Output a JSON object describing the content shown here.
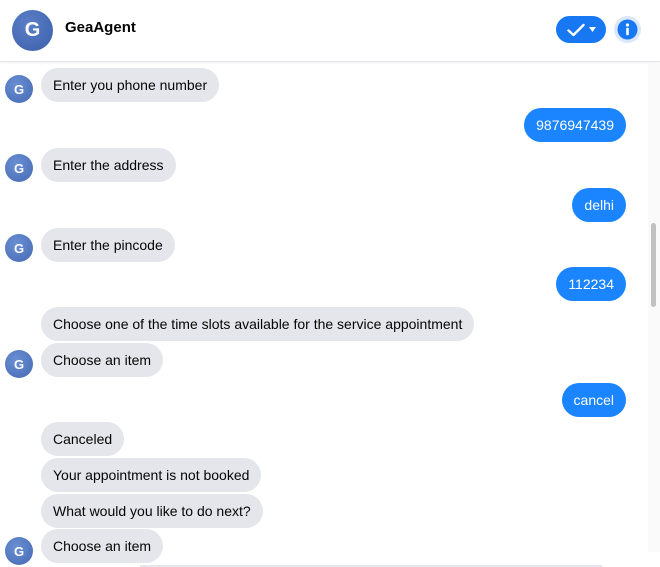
{
  "header": {
    "avatar_letter": "G",
    "title": "GeaAgent"
  },
  "icons": {
    "status": "check-icon",
    "dropdown": "chevron-down-icon",
    "info": "info-icon"
  },
  "colors": {
    "accent": "#1877f2",
    "user_bubble": "#1a85ff",
    "bot_bubble": "#e4e6eb",
    "avatar": "#4469b3"
  },
  "bot_avatar_letter": "G",
  "messages": {
    "m1": "Enter you phone number",
    "m2": "9876947439",
    "m3": "Enter the address",
    "m4": "delhi",
    "m5": "Enter the pincode",
    "m6": "112234",
    "m7": "Choose one of the time slots available for the service appointment",
    "m8": "Choose an item",
    "m9": "cancel",
    "m10": "Canceled",
    "m11": "Your appointment is not booked",
    "m12": "What would you like to do next?",
    "m13": "Choose an item"
  }
}
